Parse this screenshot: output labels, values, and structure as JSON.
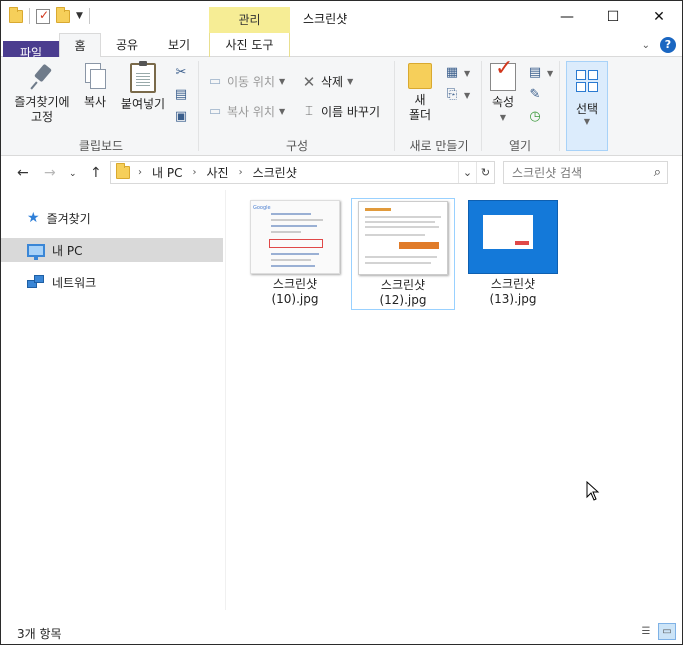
{
  "window": {
    "title": "스크린샷",
    "context_tab_group": "관리"
  },
  "window_controls": {
    "minimize": "—",
    "maximize": "☐",
    "close": "✕"
  },
  "tabs": {
    "file": "파일",
    "home": "홈",
    "share": "공유",
    "view": "보기",
    "photo_tools": "사진 도구"
  },
  "ribbon": {
    "clipboard": {
      "label": "클립보드",
      "pin": "즐겨찾기에\n고정",
      "pin_line1": "즐겨찾기에",
      "pin_line2": "고정",
      "copy": "복사",
      "paste": "붙여넣기"
    },
    "organize": {
      "label": "구성",
      "move_to": "이동 위치",
      "copy_to": "복사 위치",
      "delete": "삭제",
      "rename": "이름 바꾸기"
    },
    "new": {
      "label": "새로 만들기",
      "new_folder_line1": "새",
      "new_folder_line2": "폴더"
    },
    "open": {
      "label": "열기",
      "properties": "속성"
    },
    "select": {
      "label": "선택"
    }
  },
  "address": {
    "crumbs": [
      "내 PC",
      "사진",
      "스크린샷"
    ],
    "search_placeholder": "스크린샷 검색"
  },
  "nav": {
    "items": [
      {
        "label": "즐겨찾기",
        "icon": "star-icon"
      },
      {
        "label": "내 PC",
        "icon": "computer-icon",
        "selected": true
      },
      {
        "label": "네트워크",
        "icon": "network-icon"
      }
    ]
  },
  "files": [
    {
      "name_line1": "스크린샷",
      "name_line2": "(10).jpg",
      "selected": false
    },
    {
      "name_line1": "스크린샷",
      "name_line2": "(12).jpg",
      "selected": true
    },
    {
      "name_line1": "스크린샷",
      "name_line2": "(13).jpg",
      "selected": false
    }
  ],
  "status": {
    "item_count": "3개 항목"
  },
  "colors": {
    "file_tab": "#4b3d8f",
    "context_tab": "#f6ed95",
    "selection": "#d9d9d9",
    "accent": "#1a66c1"
  }
}
